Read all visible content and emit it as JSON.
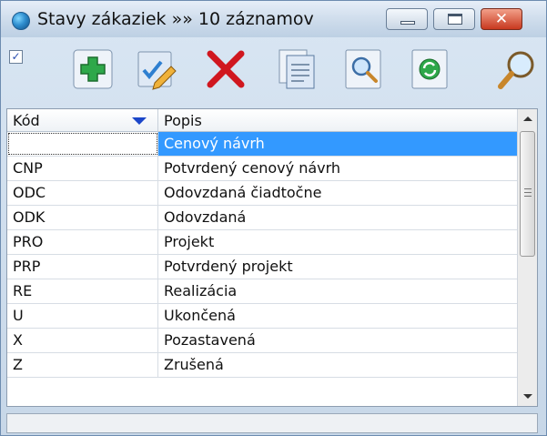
{
  "window": {
    "title": "Stavy zákaziek »» 10 záznamov",
    "close_glyph": "✕"
  },
  "toolbar": {
    "checkbox_mark": "✓",
    "buttons": [
      {
        "icon": "add-icon"
      },
      {
        "icon": "edit-icon"
      },
      {
        "icon": "delete-icon"
      },
      {
        "icon": "copy-icon"
      },
      {
        "icon": "preview-icon"
      },
      {
        "icon": "refresh-icon"
      },
      {
        "icon": "search-icon"
      }
    ]
  },
  "grid": {
    "columns": [
      "Kód",
      "Popis"
    ],
    "sort_column": "Kód",
    "selected_row": 0,
    "rows": [
      {
        "kod": "",
        "popis": "Cenový návrh"
      },
      {
        "kod": "CNP",
        "popis": "Potvrdený cenový návrh"
      },
      {
        "kod": "ODC",
        "popis": "Odovzdaná čiadtočne"
      },
      {
        "kod": "ODK",
        "popis": "Odovzdaná"
      },
      {
        "kod": "PRO",
        "popis": "Projekt"
      },
      {
        "kod": "PRP",
        "popis": "Potvrdený projekt"
      },
      {
        "kod": "RE",
        "popis": "Realizácia"
      },
      {
        "kod": "U",
        "popis": "Ukončená"
      },
      {
        "kod": "X",
        "popis": "Pozastavená"
      },
      {
        "kod": "Z",
        "popis": "Zrušená"
      }
    ]
  },
  "status": {
    "text": ""
  },
  "colors": {
    "selection": "#3399ff",
    "accent": "#1b46c9"
  }
}
